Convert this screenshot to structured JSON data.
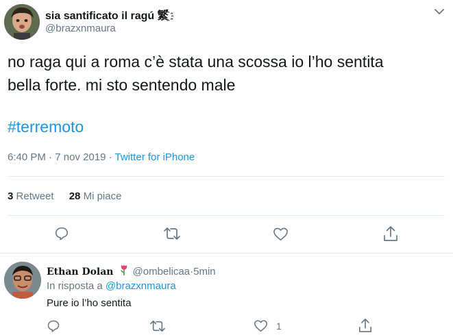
{
  "tweet": {
    "display_name": "sia santificato il ragú 繁҈̀́",
    "handle": "@brazxnmaura",
    "text_line1": "no raga qui a roma c’è stata una scossa io l’ho sentita",
    "text_line2": "bella forte. mi sto sentendo male",
    "hashtag": "#terremoto",
    "time": "6:40 PM",
    "separator": " · ",
    "date": "7 nov 2019",
    "source": "Twitter for iPhone",
    "retweets": "3",
    "retweets_label": "Retweet",
    "likes": "28",
    "likes_label": "Mi piace"
  },
  "reply": {
    "display_name": "Ethan Dolan",
    "handle": "@ombelicaa",
    "time": "5min",
    "dot": " · ",
    "reply_prefix": "In risposta a ",
    "reply_to": "@brazxnmaura",
    "text": "Pure io l’ho sentita",
    "like_count": "1"
  },
  "icons": {
    "chevron": "chevron-down-icon",
    "reply": "reply-icon",
    "retweet": "retweet-icon",
    "like": "heart-icon",
    "share": "share-icon",
    "emoji": "tulip-emoji-icon"
  },
  "colors": {
    "link": "#1b95e0",
    "secondary": "#657786",
    "divider": "#e6ecf0",
    "icon": "#657786"
  }
}
